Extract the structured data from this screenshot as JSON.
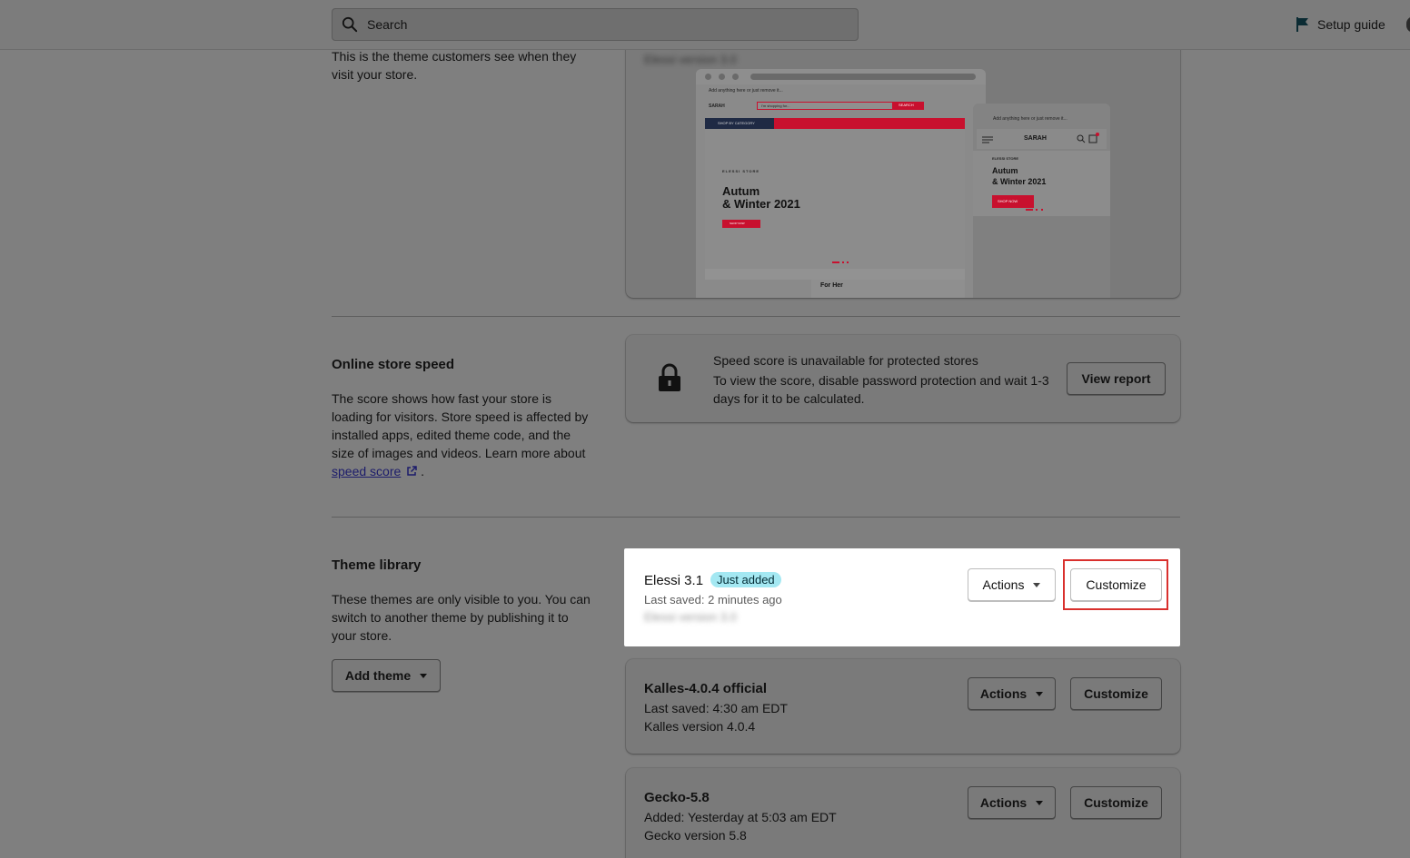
{
  "topbar": {
    "search_placeholder": "Search",
    "setup_guide_label": "Setup guide"
  },
  "current_theme": {
    "description": "This is the theme customers see when they visit your store.",
    "blurred_version_label": "Elessi version 3.0"
  },
  "preview": {
    "desktop_announcement": "Add anything here or just remove it...",
    "desktop_logo": "SARAH",
    "desktop_search_placeholder": "I'm shopping for...",
    "desktop_search_button": "SEARCH",
    "desktop_category": "SHOP BY CATEGORY",
    "desktop_store_label": "ELESSI STORE",
    "desktop_headline_1": "Autum",
    "desktop_headline_2": "& Winter 2021",
    "desktop_shop_now": "SHOP NOW",
    "desktop_footer_label": "For Her",
    "mobile_announcement": "Add anything here or just remove it...",
    "mobile_logo": "SARAH",
    "mobile_store_label": "ELESSI STORE",
    "mobile_headline_1": "Autum",
    "mobile_headline_2": "& Winter 2021",
    "mobile_shop_now": "SHOP NOW",
    "accent_color": "#c8102e"
  },
  "speed": {
    "title": "Online store speed",
    "description": "The score shows how fast your store is loading for visitors. Store speed is affected by installed apps, edited theme code, and the size of images and videos. Learn more about",
    "link_label": "speed score",
    "trailing": ".",
    "card_title": "Speed score is unavailable for protected stores",
    "card_body": "To view the score, disable password protection and wait 1-3 days for it to be calculated.",
    "view_report_label": "View report"
  },
  "library": {
    "title": "Theme library",
    "description": "These themes are only visible to you. You can switch to another theme by publishing it to your store.",
    "add_theme_label": "Add theme",
    "themes": [
      {
        "name": "Elessi 3.1",
        "badge": "Just added",
        "meta": "Last saved: 2 minutes ago",
        "version": "Elessi version 3.0",
        "actions_label": "Actions",
        "customize_label": "Customize"
      },
      {
        "name": "Kalles-4.0.4 official",
        "meta": "Last saved: 4:30 am EDT",
        "version": "Kalles version 4.0.4",
        "actions_label": "Actions",
        "customize_label": "Customize"
      },
      {
        "name": "Gecko-5.8",
        "meta": "Added: Yesterday at 5:03 am EDT",
        "version": "Gecko version 5.8",
        "actions_label": "Actions",
        "customize_label": "Customize"
      }
    ]
  },
  "colors": {
    "overlay_bg": "#7f7f7f",
    "highlight_outline": "#d9302d",
    "badge_bg": "#a4e8f2"
  }
}
